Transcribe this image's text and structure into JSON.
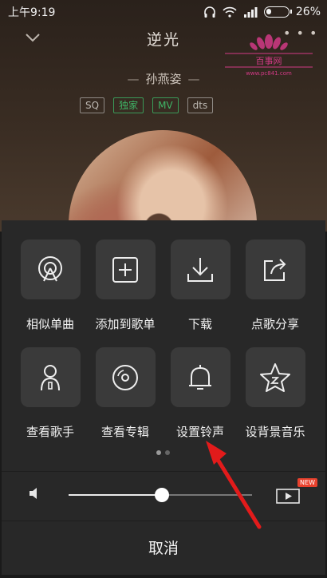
{
  "status_bar": {
    "time": "上午9:19",
    "battery": "26%",
    "battery_level": 0.26
  },
  "player": {
    "title": "逆光",
    "artist": "孙燕姿",
    "badges": [
      "SQ",
      "独家",
      "MV",
      "dts"
    ],
    "watermark_text": [
      "百事网",
      "www.pc841.com"
    ]
  },
  "sheet": {
    "row1": [
      {
        "label": "相似单曲",
        "icon": "radar-icon"
      },
      {
        "label": "添加到歌单",
        "icon": "add-square-icon"
      },
      {
        "label": "下载",
        "icon": "download-icon"
      },
      {
        "label": "点歌分享",
        "icon": "share-icon"
      }
    ],
    "row2": [
      {
        "label": "查看歌手",
        "icon": "singer-icon"
      },
      {
        "label": "查看专辑",
        "icon": "disc-icon"
      },
      {
        "label": "设置铃声",
        "icon": "bell-icon"
      },
      {
        "label": "设背景音乐",
        "icon": "star-music-icon"
      }
    ],
    "page_count": 2,
    "active_page": 1,
    "volume_level": 0.51,
    "video_new_badge": "NEW",
    "cancel_label": "取消"
  },
  "colors": {
    "sheet_bg": "#282828",
    "tile_bg": "#3a3a3a",
    "badge_green": "#3fb466",
    "arrow_red": "#e21b1b"
  }
}
